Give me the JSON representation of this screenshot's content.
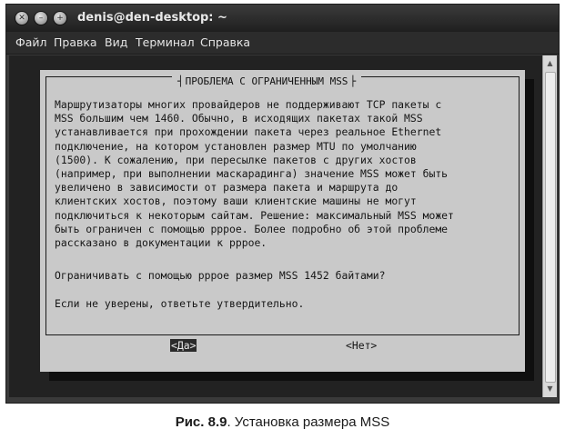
{
  "window": {
    "title": "denis@den-desktop: ~",
    "close_glyph": "✕",
    "min_glyph": "–",
    "max_glyph": "+"
  },
  "menu": [
    "Файл",
    "Правка",
    "Вид",
    "Терминал",
    "Справка"
  ],
  "dialog": {
    "title": "ПРОБЛЕМА С ОГРАНИЧЕННЫМ MSS",
    "body": "Маршрутизаторы многих провайдеров не поддерживают TCP пакеты с\nMSS большим чем 1460. Обычно, в исходящих пакетах такой MSS\nустанавливается при прохождении пакета через реальное Ethernet\nподключение, на котором установлен размер MTU по умолчанию\n(1500). К сожалению, при пересылке пакетов с других хостов\n(например, при выполнении маскарадинга) значение MSS может быть\nувеличено в зависимости от размера пакета и маршрута до\nклиентских хостов, поэтому ваши клиентские машины не могут\nподключиться к некоторым сайтам. Решение: максимальный MSS может\nбыть ограничен с помощью pppoe. Более подробно об этой проблеме\nрассказано в документации к pppoe.",
    "question": "Ограничивать с помощью pppoe размер MSS 1452 байтами?",
    "advice": "Если не уверены, ответьте утвердительно.",
    "yes_label": "<Да>",
    "no_label": "<Нет>"
  },
  "caption": {
    "number": "Рис. 8.9",
    "text": ". Установка размера MSS"
  }
}
